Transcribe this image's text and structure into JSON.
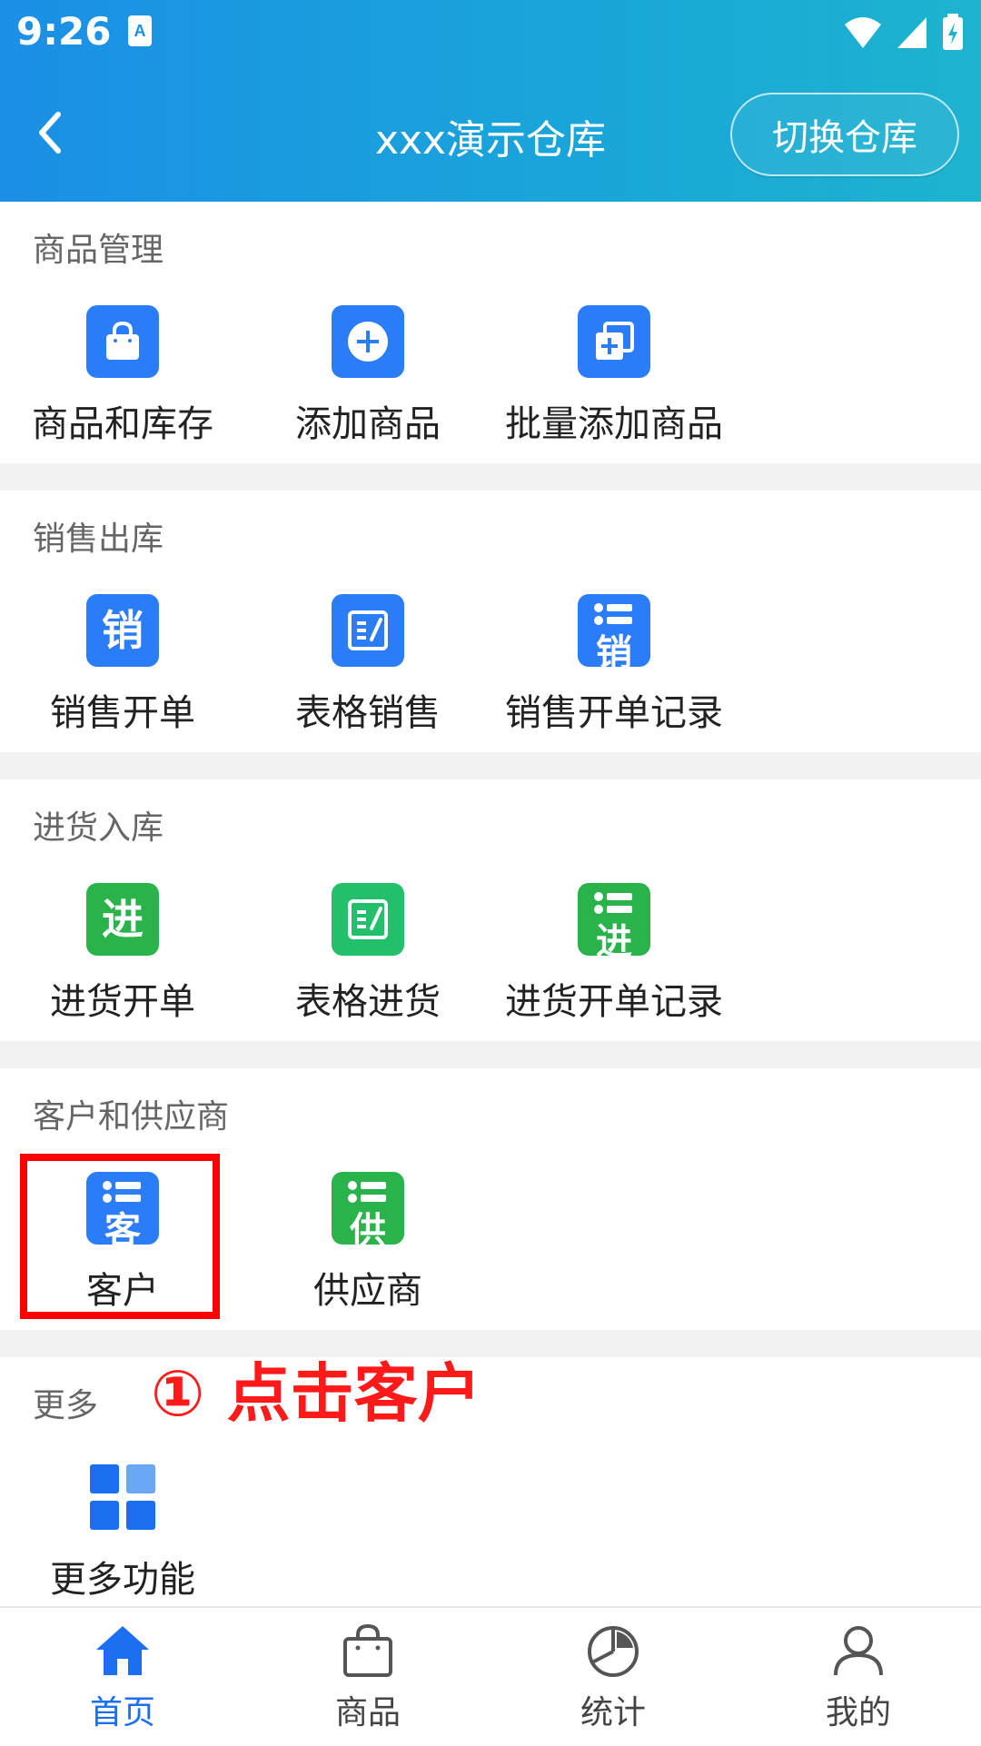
{
  "status": {
    "time": "9:26"
  },
  "header": {
    "title": "xxx演示仓库",
    "switch_label": "切换仓库"
  },
  "sections": {
    "goods": {
      "title": "商品管理",
      "items": [
        {
          "label": "商品和库存",
          "icon": "shopping-bag-icon"
        },
        {
          "label": "添加商品",
          "icon": "plus-circle-icon"
        },
        {
          "label": "批量添加商品",
          "icon": "batch-add-icon"
        }
      ]
    },
    "sales": {
      "title": "销售出库",
      "items": [
        {
          "label": "销售开单",
          "icon_char": "销"
        },
        {
          "label": "表格销售",
          "icon": "table-edit-icon"
        },
        {
          "label": "销售开单记录",
          "icon_char": "销"
        }
      ]
    },
    "purchase": {
      "title": "进货入库",
      "items": [
        {
          "label": "进货开单",
          "icon_char": "进"
        },
        {
          "label": "表格进货",
          "icon": "table-edit-icon"
        },
        {
          "label": "进货开单记录",
          "icon_char": "进"
        }
      ]
    },
    "partners": {
      "title": "客户和供应商",
      "items": [
        {
          "label": "客户",
          "icon_char": "客"
        },
        {
          "label": "供应商",
          "icon_char": "供"
        }
      ]
    },
    "more": {
      "title": "更多",
      "items": [
        {
          "label": "更多功能",
          "icon": "grid-icon"
        }
      ]
    }
  },
  "annotation": {
    "text": "① 点击客户"
  },
  "bottom_nav": [
    {
      "label": "首页",
      "icon": "home-icon",
      "active": true
    },
    {
      "label": "商品",
      "icon": "bag-icon",
      "active": false
    },
    {
      "label": "统计",
      "icon": "pie-chart-icon",
      "active": false
    },
    {
      "label": "我的",
      "icon": "user-icon",
      "active": false
    }
  ],
  "colors": {
    "accent": "#1b6ff0",
    "blue_icon": "#2b7cf7",
    "green_icon": "#29b34a",
    "highlight": "#ff0000"
  }
}
